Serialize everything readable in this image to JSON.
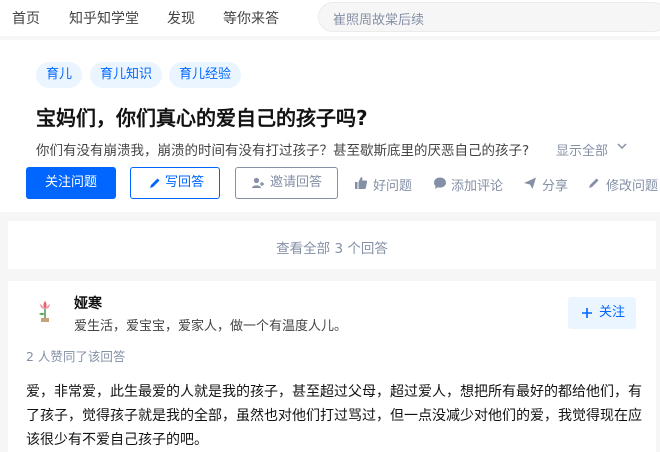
{
  "topnav": {
    "items": [
      "首页",
      "知乎知学堂",
      "发现",
      "等你来答"
    ],
    "search_placeholder": "崔照周故棠后续"
  },
  "question": {
    "tags": [
      "育儿",
      "育儿知识",
      "育儿经验"
    ],
    "title": "宝妈们，你们真心的爱自己的孩子吗?",
    "detail": "你们有没有崩溃我，崩溃的时间有没有打过孩子？甚至歇斯底里的厌恶自己的孩子?",
    "show_all": "显示全部",
    "buttons": {
      "follow": "关注问题",
      "write": "写回答",
      "invite": "邀请回答",
      "good": "好问题",
      "comment": "添加评论",
      "share": "分享",
      "edit": "修改问题"
    }
  },
  "view_all": "查看全部 3 个回答",
  "answer": {
    "author": "娅寒",
    "bio": "爱生活，爱宝宝，爱家人，做一个有温度人儿。",
    "follow_label": "关注",
    "votes": "2 人赞同了该回答",
    "content": "爱，非常爱，此生最爱的人就是我的孩子，甚至超过父母，超过爱人，想把所有最好的都给他们，有了孩子，觉得孩子就是我的全部，虽然也对他们打过骂过，但一点没减少对他们的爱，我觉得现在应该很少有不爱自己孩子的吧。"
  },
  "colors": {
    "brand": "#0066ff",
    "tag_bg": "#ebf5ff",
    "muted": "#8590a6"
  }
}
